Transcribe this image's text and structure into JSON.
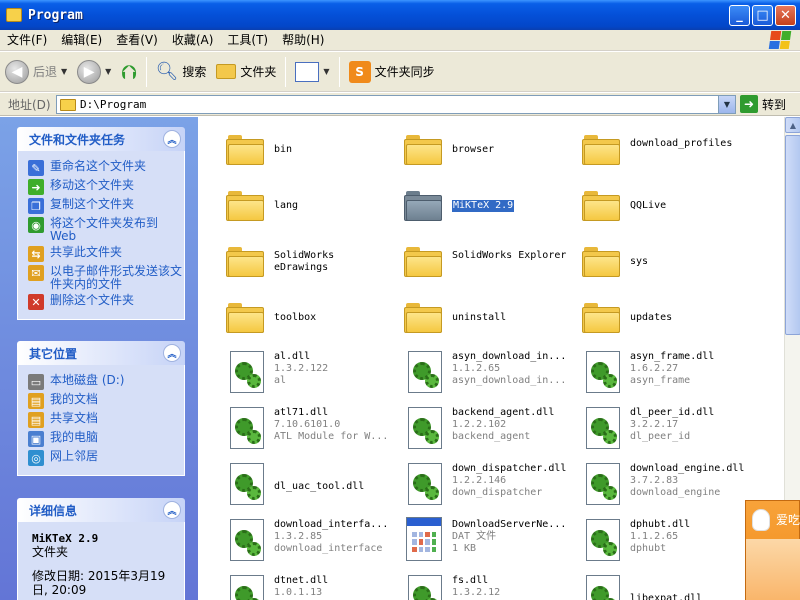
{
  "window": {
    "title": "Program"
  },
  "menu": [
    "文件(F)",
    "编辑(E)",
    "查看(V)",
    "收藏(A)",
    "工具(T)",
    "帮助(H)"
  ],
  "toolbar": {
    "back": "后退",
    "search": "搜索",
    "folders": "文件夹",
    "sync": "文件夹同步"
  },
  "address": {
    "label": "地址(D)",
    "path": "D:\\Program",
    "go": "转到"
  },
  "sidebar": {
    "tasks": {
      "title": "文件和文件夹任务",
      "items": [
        {
          "label": "重命名这个文件夹",
          "icon": "rename-icon"
        },
        {
          "label": "移动这个文件夹",
          "icon": "move-icon"
        },
        {
          "label": "复制这个文件夹",
          "icon": "copy-icon"
        },
        {
          "label": "将这个文件夹发布到 Web",
          "icon": "publish-web-icon"
        },
        {
          "label": "共享此文件夹",
          "icon": "share-icon"
        },
        {
          "label": "以电子邮件形式发送该文件夹内的文件",
          "icon": "email-icon"
        },
        {
          "label": "删除这个文件夹",
          "icon": "delete-icon"
        }
      ]
    },
    "places": {
      "title": "其它位置",
      "items": [
        {
          "label": "本地磁盘 (D:)",
          "icon": "disk-icon"
        },
        {
          "label": "我的文档",
          "icon": "my-documents-icon"
        },
        {
          "label": "共享文档",
          "icon": "shared-documents-icon"
        },
        {
          "label": "我的电脑",
          "icon": "my-computer-icon"
        },
        {
          "label": "网上邻居",
          "icon": "network-icon"
        }
      ]
    },
    "details": {
      "title": "详细信息",
      "name": "MiKTeX 2.9",
      "type": "文件夹",
      "modified_1": "修改日期: 2015年3月19",
      "modified_2": "日, 20:09"
    }
  },
  "files": [
    {
      "kind": "folder",
      "name": "bin"
    },
    {
      "kind": "folder",
      "name": "browser"
    },
    {
      "kind": "folder",
      "name": "download_profiles"
    },
    {
      "kind": "folder",
      "name": "lang"
    },
    {
      "kind": "folder",
      "name": "MiKTeX 2.9",
      "selected": true
    },
    {
      "kind": "folder",
      "name": "QQLive"
    },
    {
      "kind": "folder",
      "name": "SolidWorks eDrawings"
    },
    {
      "kind": "folder",
      "name": "SolidWorks Explorer"
    },
    {
      "kind": "folder",
      "name": "sys"
    },
    {
      "kind": "folder",
      "name": "toolbox"
    },
    {
      "kind": "folder",
      "name": "uninstall"
    },
    {
      "kind": "folder",
      "name": "updates"
    },
    {
      "kind": "dll",
      "name": "al.dll",
      "version": "1.3.2.122",
      "desc": "al"
    },
    {
      "kind": "dll",
      "name": "asyn_download_in...",
      "version": "1.1.2.65",
      "desc": "asyn_download_in..."
    },
    {
      "kind": "dll",
      "name": "asyn_frame.dll",
      "version": "1.6.2.27",
      "desc": "asyn_frame"
    },
    {
      "kind": "dll",
      "name": "atl71.dll",
      "version": "7.10.6101.0",
      "desc": "ATL Module for W..."
    },
    {
      "kind": "dll",
      "name": "backend_agent.dll",
      "version": "1.2.2.102",
      "desc": "backend_agent"
    },
    {
      "kind": "dll",
      "name": "dl_peer_id.dll",
      "version": "3.2.2.17",
      "desc": "dl_peer_id"
    },
    {
      "kind": "dll",
      "name": "dl_uac_tool.dll",
      "version": "",
      "desc": ""
    },
    {
      "kind": "dll",
      "name": "down_dispatcher.dll",
      "version": "1.2.2.146",
      "desc": "down_dispatcher"
    },
    {
      "kind": "dll",
      "name": "download_engine.dll",
      "version": "3.7.2.83",
      "desc": "download_engine"
    },
    {
      "kind": "dll",
      "name": "download_interfa...",
      "version": "1.3.2.85",
      "desc": "download_interface"
    },
    {
      "kind": "dat",
      "name": "DownloadServerNe...",
      "version": "DAT 文件",
      "desc": "1 KB"
    },
    {
      "kind": "dll",
      "name": "dphubt.dll",
      "version": "1.1.2.65",
      "desc": "dphubt"
    },
    {
      "kind": "dll",
      "name": "dtnet.dll",
      "version": "1.0.1.13",
      "desc": ""
    },
    {
      "kind": "dll",
      "name": "fs.dll",
      "version": "1.3.2.12",
      "desc": ""
    },
    {
      "kind": "dll",
      "name": "libexpat.dll",
      "version": "",
      "desc": ""
    }
  ],
  "notification": {
    "text": "爱吃"
  }
}
